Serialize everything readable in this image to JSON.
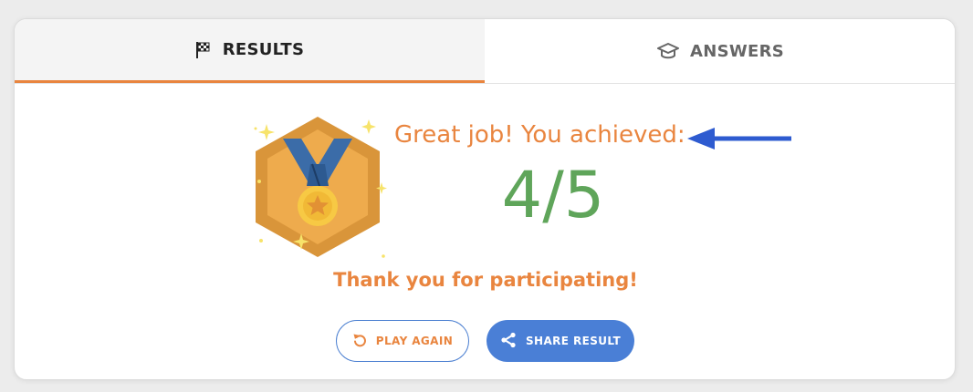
{
  "tabs": {
    "results_label": "RESULTS",
    "answers_label": "ANSWERS",
    "active": "results",
    "results_icon": "checkered-flag-icon",
    "answers_icon": "graduation-cap-icon"
  },
  "result": {
    "heading": "Great job! You achieved:",
    "score": "4/5",
    "thank_you": "Thank you for participating!"
  },
  "badge": {
    "icon": "medal-badge-icon"
  },
  "buttons": {
    "play_again_label": "PLAY AGAIN",
    "play_again_icon": "replay-icon",
    "share_label": "SHARE RESULT",
    "share_icon": "share-icon"
  },
  "colors": {
    "accent_orange": "#e9853f",
    "score_green": "#5fa55a",
    "primary_blue": "#4a7fd6",
    "annotation_arrow": "#2e5bd0"
  }
}
